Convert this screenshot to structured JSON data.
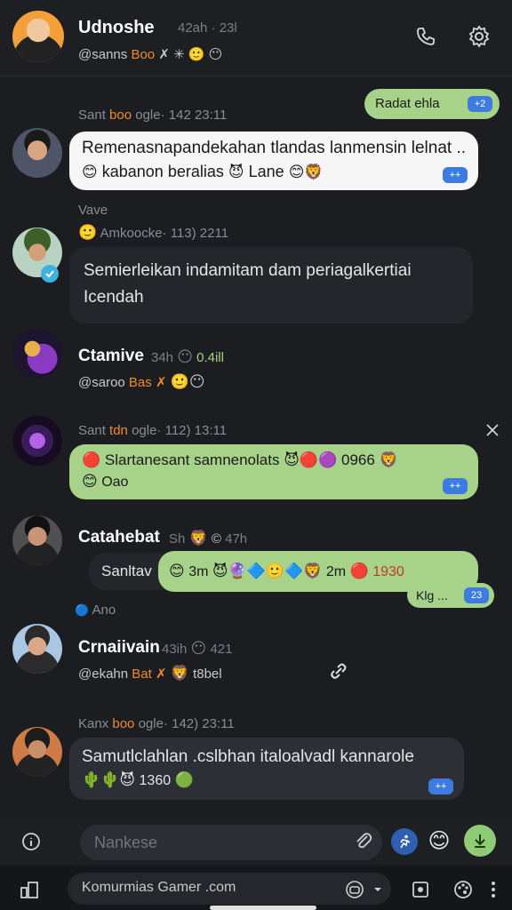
{
  "header": {
    "name": "Udnoshe",
    "meta": "42ah · 23l",
    "handle": "@sanns",
    "handle_accent": "Boo",
    "status_glyphs": "✗ ✳ 🙂 😶"
  },
  "messages": [
    {
      "meta_prefix": "Sant",
      "meta_accent": "boo",
      "meta_rest": "ogle· 142 23:11"
    },
    {
      "text": "Remenasnapandekahan tlandas lanmensin lelnat ...",
      "text2": "kabanon beralias",
      "text3": "Lane",
      "chip": "++"
    },
    {
      "label": "Vave",
      "meta": "Amkoocke· 113) 2211"
    },
    {
      "text": "Semierleikan indamitam dam periagalkertiai",
      "text2": "Icendah"
    },
    {
      "meta_prefix": "Sant",
      "meta_accent": "tdn",
      "meta_rest": "ogle· 112) 13:11"
    },
    {
      "text": "Slartanesant samnenolats",
      "text_num": "0966",
      "text2": "Oao",
      "chip": "++"
    },
    {
      "reply_label": "Sanltav",
      "text": "3m",
      "text_b": "2m",
      "text_c": "1930",
      "badge": "Klg ...",
      "badge_num": "23"
    },
    {
      "label": "Ano"
    },
    {
      "meta_prefix": "Kanx",
      "meta_accent": "boo",
      "meta_rest": "ogle· 142) 23:11"
    },
    {
      "text": "Samutlclahlan .cslbhan italoalvadl kannarole",
      "text_num": "1360",
      "chip": "++"
    }
  ],
  "outgoing_top": {
    "text": "Radat ehla",
    "chip": "+2"
  },
  "users": [
    {
      "name": "Ctamive",
      "meta": "34h",
      "stat": "0.4ill",
      "handle": "@saroo",
      "accent": "Bas"
    },
    {
      "name": "Catahebat",
      "meta": "Sh",
      "stat": "47h"
    },
    {
      "name": "Crnaiivain",
      "meta": "43ih",
      "stat": "421",
      "handle": "@ekahn",
      "accent": "Bat",
      "extra": "t8bel"
    }
  ],
  "input": {
    "placeholder": "Nankese"
  },
  "bottom": {
    "text": "Komurmias Gamer .com"
  },
  "colors": {
    "accent": "#f08b2c",
    "green": "#a6d28a",
    "blue": "#3d7be0"
  }
}
